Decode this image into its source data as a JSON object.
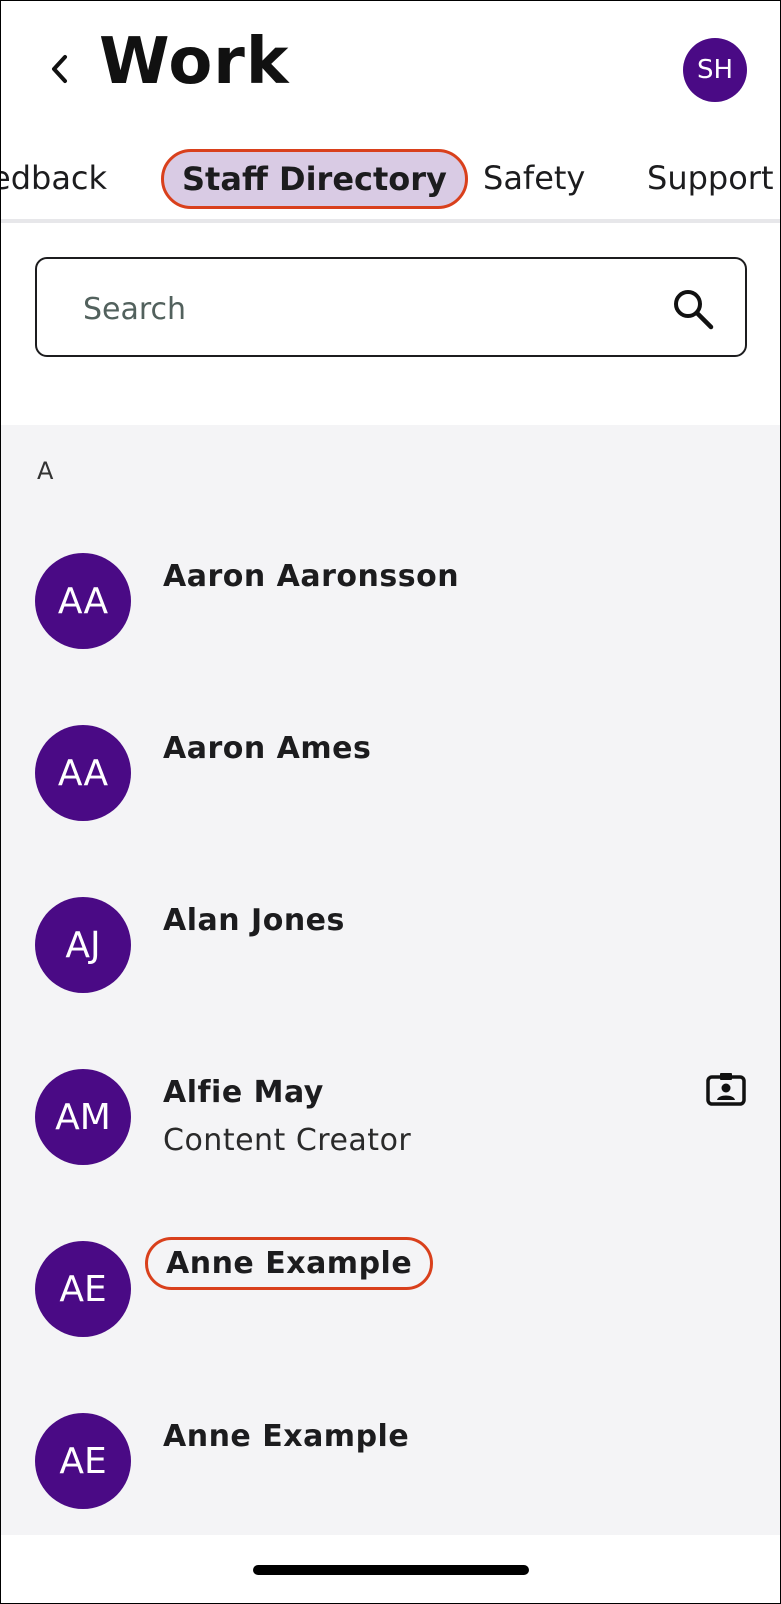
{
  "header": {
    "title": "Work",
    "avatar_initials": "SH"
  },
  "tabs": [
    {
      "label": "edback"
    },
    {
      "label": "Staff Directory",
      "active": true
    },
    {
      "label": "Safety"
    },
    {
      "label": "Support"
    }
  ],
  "search": {
    "placeholder": "Search",
    "value": ""
  },
  "directory": {
    "section_letter": "A",
    "people": [
      {
        "initials": "AA",
        "name": "Aaron Aaronsson",
        "role": ""
      },
      {
        "initials": "AA",
        "name": "Aaron Ames",
        "role": ""
      },
      {
        "initials": "AJ",
        "name": "Alan Jones",
        "role": ""
      },
      {
        "initials": "AM",
        "name": "Alfie May",
        "role": "Content Creator",
        "icon": "contact-badge-icon"
      },
      {
        "initials": "AE",
        "name": "Anne Example",
        "role": "",
        "highlighted": true
      },
      {
        "initials": "AE",
        "name": "Anne Example",
        "role": ""
      }
    ]
  },
  "colors": {
    "avatar": "#4a0a85",
    "active_tab_bg": "#d9cbe4",
    "highlight_outline": "#d9401c",
    "list_bg": "#f4f4f6"
  }
}
